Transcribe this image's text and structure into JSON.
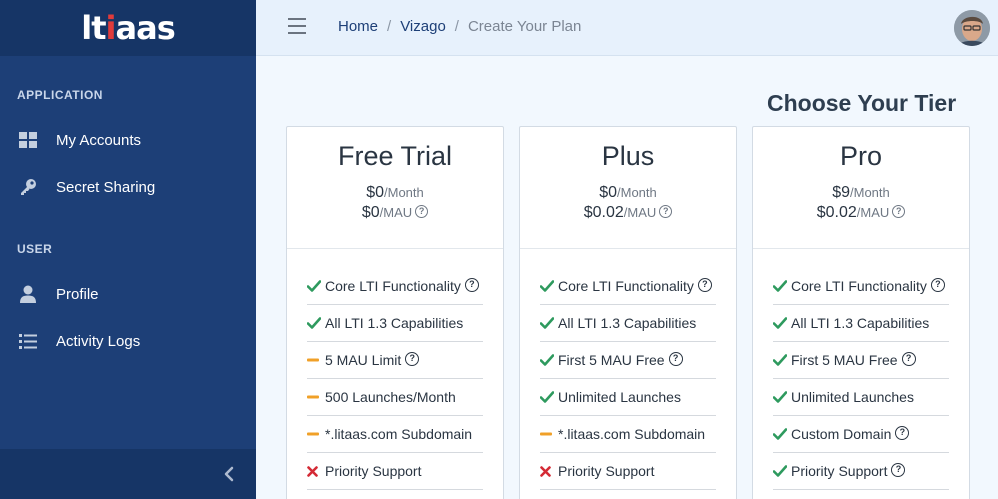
{
  "brand": {
    "name_main": "lt",
    "name_accent": "i",
    "name_rest": "aas"
  },
  "sidebar": {
    "sections": [
      {
        "title": "APPLICATION"
      },
      {
        "title": "USER"
      }
    ],
    "items": [
      {
        "label": "My Accounts",
        "icon": "grid-icon"
      },
      {
        "label": "Secret Sharing",
        "icon": "key-icon"
      },
      {
        "label": "Profile",
        "icon": "user-icon"
      },
      {
        "label": "Activity Logs",
        "icon": "list-icon"
      }
    ]
  },
  "header": {
    "breadcrumb": [
      "Home",
      "Vizago",
      "Create Your Plan"
    ],
    "separator": "/"
  },
  "main": {
    "title": "Choose Your Tier"
  },
  "tiers": [
    {
      "name": "Free Trial",
      "monthly": "$0",
      "monthly_unit": "/Month",
      "mau": "$0",
      "mau_unit": "/MAU",
      "features": [
        {
          "text": "Core LTI Functionality",
          "status": "check",
          "help": true
        },
        {
          "text": "All LTI 1.3 Capabilities",
          "status": "check",
          "help": false
        },
        {
          "text": "5 MAU Limit",
          "status": "limited",
          "help": true
        },
        {
          "text": "500 Launches/Month",
          "status": "limited",
          "help": false
        },
        {
          "text": "*.litaas.com Subdomain",
          "status": "limited",
          "help": false
        },
        {
          "text": "Priority Support",
          "status": "cross",
          "help": false
        }
      ]
    },
    {
      "name": "Plus",
      "monthly": "$0",
      "monthly_unit": "/Month",
      "mau": "$0.02",
      "mau_unit": "/MAU",
      "features": [
        {
          "text": "Core LTI Functionality",
          "status": "check",
          "help": true
        },
        {
          "text": "All LTI 1.3 Capabilities",
          "status": "check",
          "help": false
        },
        {
          "text": "First 5 MAU Free",
          "status": "check",
          "help": true
        },
        {
          "text": "Unlimited Launches",
          "status": "check",
          "help": false
        },
        {
          "text": "*.litaas.com Subdomain",
          "status": "limited",
          "help": false
        },
        {
          "text": "Priority Support",
          "status": "cross",
          "help": false
        }
      ]
    },
    {
      "name": "Pro",
      "monthly": "$9",
      "monthly_unit": "/Month",
      "mau": "$0.02",
      "mau_unit": "/MAU",
      "features": [
        {
          "text": "Core LTI Functionality",
          "status": "check",
          "help": true
        },
        {
          "text": "All LTI 1.3 Capabilities",
          "status": "check",
          "help": false
        },
        {
          "text": "First 5 MAU Free",
          "status": "check",
          "help": true
        },
        {
          "text": "Unlimited Launches",
          "status": "check",
          "help": false
        },
        {
          "text": "Custom Domain",
          "status": "check",
          "help": true
        },
        {
          "text": "Priority Support",
          "status": "check",
          "help": true
        }
      ]
    }
  ],
  "colors": {
    "sidebar_bg": "#1d3f77",
    "brand_accent": "#e03b3b",
    "check": "#2e9a5e",
    "limited": "#f0a028",
    "cross": "#d42a35"
  },
  "help_glyph": "?"
}
